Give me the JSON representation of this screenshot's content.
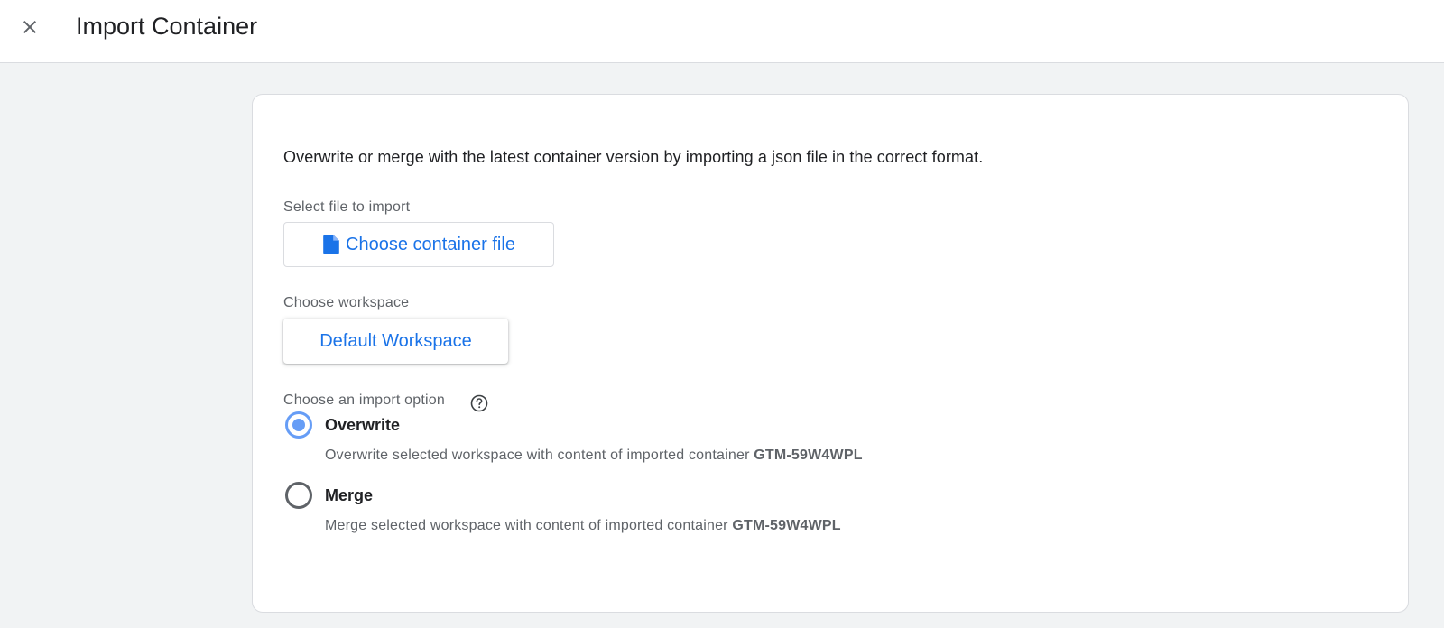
{
  "header": {
    "title": "Import Container",
    "close_icon": "close-icon"
  },
  "card": {
    "description": "Overwrite or merge with the latest container version by importing a json file in the correct format.",
    "file": {
      "label": "Select file to import",
      "button_label": "Choose container file",
      "icon": "file-icon"
    },
    "workspace": {
      "label": "Choose workspace",
      "button_label": "Default Workspace"
    },
    "import_option": {
      "label": "Choose an import option",
      "help_icon": "help-icon",
      "selected": "overwrite",
      "options": [
        {
          "id": "overwrite",
          "label": "Overwrite",
          "description": "Overwrite selected workspace with content of imported container",
          "container_id": "GTM-59W4WPL"
        },
        {
          "id": "merge",
          "label": "Merge",
          "description": "Merge selected workspace with content of imported container",
          "container_id": "GTM-59W4WPL"
        }
      ]
    }
  },
  "colors": {
    "accent": "#1a73e8",
    "radio_selected": "#669df6",
    "background": "#f1f3f4"
  }
}
